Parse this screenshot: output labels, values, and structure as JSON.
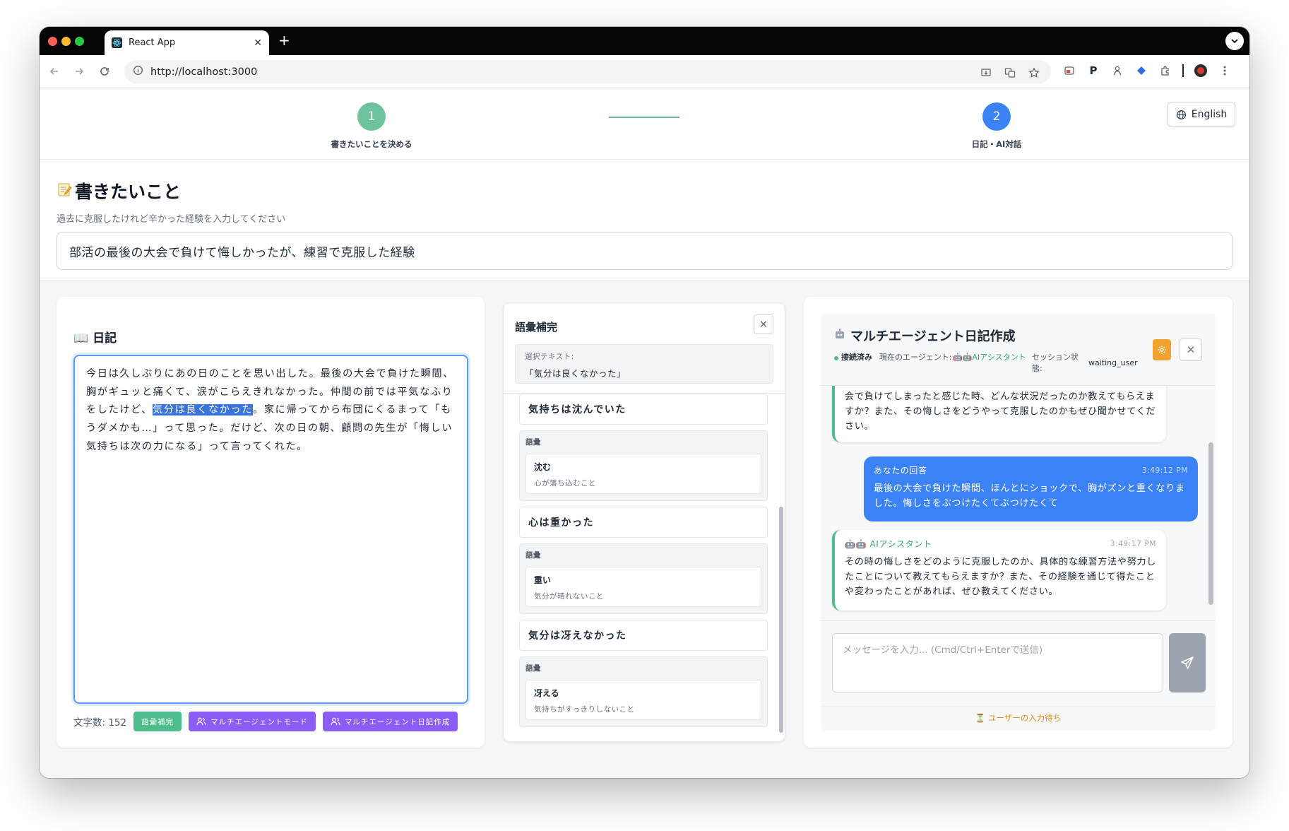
{
  "browser": {
    "tab_title": "React App",
    "new_tab": "+",
    "url": "http://localhost:3000"
  },
  "stepper": {
    "steps": [
      {
        "number": "1",
        "label": "書きたいことを決める",
        "color": "#5fbf94"
      },
      {
        "number": "2",
        "label": "日記・AI対話",
        "color": "#3b82f6"
      }
    ],
    "language_button": "English"
  },
  "topic": {
    "title": "書きたいこと",
    "subtitle": "過去に克服したけれど辛かった経験を入力してください",
    "value": "部活の最後の大会で負けて悔しかったが、練習で克服した経験"
  },
  "diary": {
    "title": "📖 日記",
    "text_before": "今日は久しぶりにあの日のことを思い出した。最後の大会で負けた瞬間、胸がギュッと痛くて、涙がこらえきれなかった。仲間の前では平気なふりをしたけど、",
    "text_selected": "気分は良くなかった",
    "text_after": "。家に帰ってから布団にくるまって「もうダメかも…」って思った。だけど、次の日の朝、顧問の先生が「悔しい気持ちは次の力になる」って言ってくれた。",
    "char_count": "文字数: 152",
    "buttons": {
      "vocab": "語彙補完",
      "multi_agent_mode": "マルチエージェントモード",
      "multi_agent_diary": "マルチエージェント日記作成"
    }
  },
  "vocab": {
    "title": "語彙補完",
    "selection_label": "選択テキスト:",
    "selection_text": "「気分は良くなかった」",
    "items": [
      {
        "phrase": "気持ちは沈んでいた",
        "category": "語彙",
        "word": "沈む",
        "meaning": "心が落ち込むこと"
      },
      {
        "phrase": "心は重かった",
        "category": "語彙",
        "word": "重い",
        "meaning": "気分が晴れないこと"
      },
      {
        "phrase": "気分は冴えなかった",
        "category": "語彙",
        "word": "冴える",
        "meaning": "気持ちがすっきりしないこと"
      }
    ]
  },
  "chat": {
    "title": "マルチエージェント日記作成",
    "status_connected": "接続済み",
    "current_agent_label": "現在のエージェント:",
    "current_agent": "🤖🤖AIアシスタント",
    "session_label": "セッション状態:",
    "session_state": "waiting_user",
    "messages": [
      {
        "role": "ai",
        "name": "",
        "time": "",
        "text": "こんにちは！日記のテーマについて話し合いましょう。部活の最後の大会で負けてしまったと感じた時、どんな状況だったのか教えてもらえますか？また、その悔しさをどうやって克服したのかもぜひ聞かせてください。"
      },
      {
        "role": "user",
        "name": "あなたの回答",
        "time": "3:49:12 PM",
        "text": "最後の大会で負けた瞬間、ほんとにショックで、胸がズンと重くなりました。悔しさをぶつけたくてぶつけたくて"
      },
      {
        "role": "ai",
        "name": "🤖🤖 AIアシスタント",
        "time": "3:49:17 PM",
        "text": "その時の悔しさをどのように克服したのか、具体的な練習方法や努力したことについて教えてもらえますか？また、その経験を通じて得たことや変わったことがあれば、ぜひ教えてください。"
      }
    ],
    "input_placeholder": "メッセージを入力... (Cmd/Ctrl+Enterで送信)",
    "status_line": "⏳ ユーザーの入力待ち"
  }
}
